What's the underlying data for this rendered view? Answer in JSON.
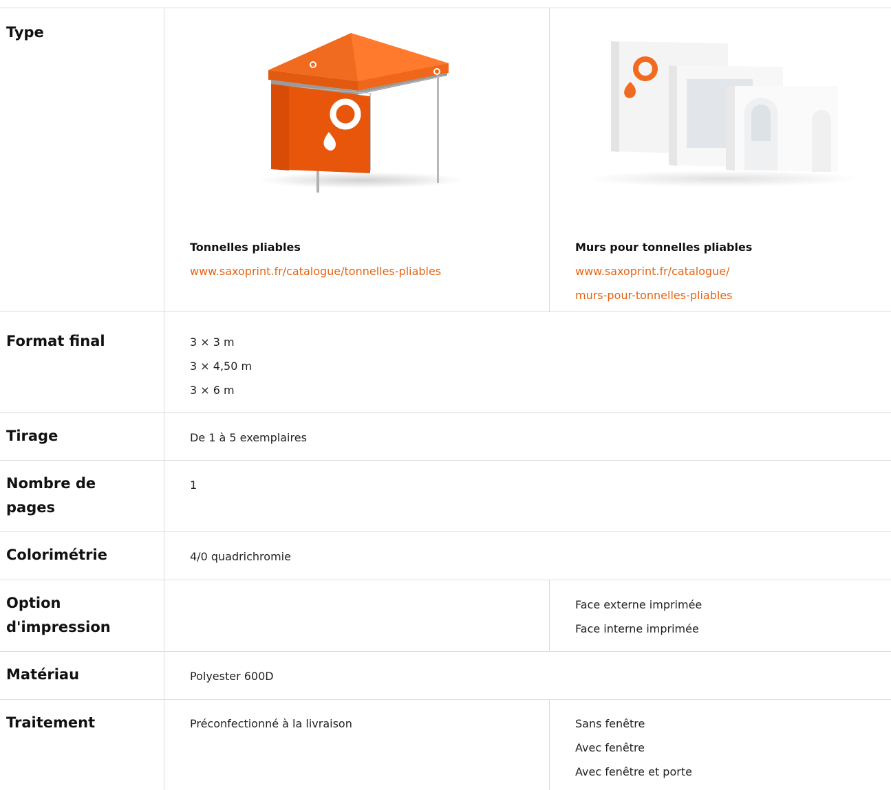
{
  "colors": {
    "accent": "#e8620f",
    "divider": "#dcdcdc",
    "label_text": "#111111"
  },
  "rows": {
    "type": {
      "label": "Type",
      "products": [
        {
          "title": "Tonnelles pliables",
          "link_lines": [
            "www.saxoprint.fr/catalogue/tonnelles-pliables"
          ],
          "image_icon": "orange-folding-tent-image"
        },
        {
          "title": "Murs pour tonnelles pliables",
          "link_lines": [
            "www.saxoprint.fr/catalogue/",
            "murs-pour-tonnelles-pliables"
          ],
          "image_icon": "tent-side-walls-image"
        }
      ]
    },
    "format": {
      "label": "Format final",
      "values": [
        "3 × 3 m",
        "3 × 4,50 m",
        "3 × 6 m"
      ]
    },
    "tirage": {
      "label": "Tirage",
      "value": "De 1 à 5 exemplaires"
    },
    "pages": {
      "label": "Nombre de pages",
      "value": "1"
    },
    "colorimetrie": {
      "label": "Colorimétrie",
      "value": "4/0 quadrichromie"
    },
    "impression": {
      "label": "Option d'impression",
      "left_value": "",
      "right_values": [
        "Face externe imprimée",
        "Face interne imprimée"
      ]
    },
    "materiau": {
      "label": "Matériau",
      "value": "Polyester 600D"
    },
    "traitement": {
      "label": "Traitement",
      "left_value": "Préconfectionné à la livraison",
      "right_values": [
        "Sans fenêtre",
        "Avec fenêtre",
        "Avec fenêtre et porte"
      ]
    }
  }
}
